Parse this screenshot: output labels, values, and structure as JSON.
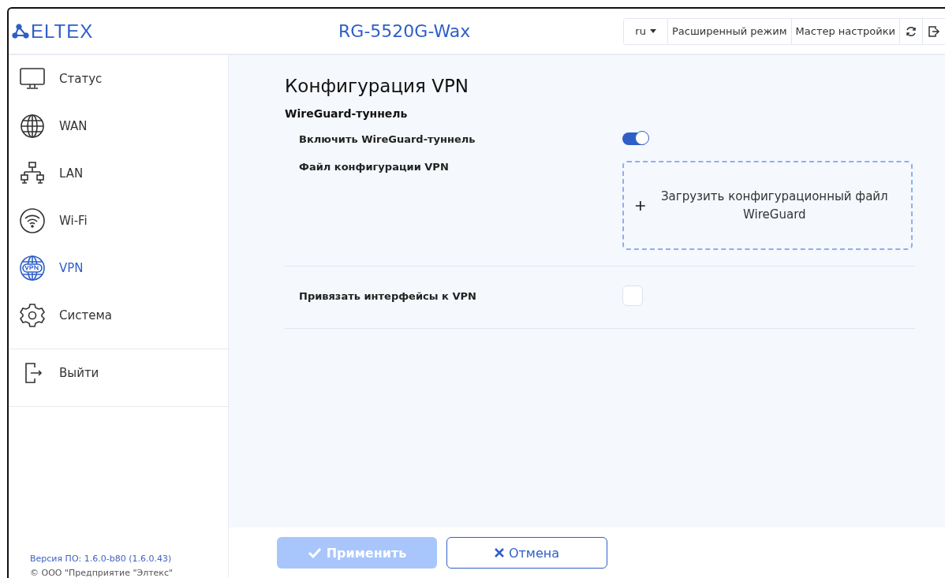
{
  "header": {
    "logo": "ELTEX",
    "title": "RG-5520G-Wax",
    "language": "ru",
    "buttons": [
      {
        "label": "Расширенный режим",
        "kind": "text"
      },
      {
        "label": "Мастер настройки",
        "kind": "text"
      },
      {
        "kind": "refresh"
      },
      {
        "kind": "logout"
      }
    ]
  },
  "sidebar": {
    "items": [
      {
        "label": "Статус",
        "kind": "monitor",
        "selected": false
      },
      {
        "label": "WAN",
        "kind": "globe",
        "selected": false
      },
      {
        "label": "LAN",
        "kind": "network",
        "selected": false
      },
      {
        "label": "Wi-Fi",
        "kind": "wifi",
        "selected": false
      },
      {
        "label": "VPN",
        "kind": "vpn",
        "selected": true
      },
      {
        "label": "Система",
        "kind": "gear",
        "selected": false
      }
    ],
    "exit": "Выйти",
    "version": "Версия ПО: 1.6.0-b80 (1.6.0.43)",
    "copyright": "© ООО \"Предприятие \"Элтекс\""
  },
  "content": {
    "title": "Конфигурация VPN",
    "section": "WireGuard-туннель",
    "rows": [
      {
        "kind": "toggle",
        "label": "Включить WireGuard-туннель",
        "on": true
      },
      {
        "kind": "upload",
        "label": "Файл конфигурации VPN",
        "button": "Загрузить конфигурационный файл WireGuard"
      },
      {
        "kind": "checkbox",
        "label": "Привязать интерфейсы к VPN",
        "checked": false
      }
    ]
  },
  "footer": {
    "apply": {
      "label": "Применить",
      "disabled": true
    },
    "cancel": {
      "label": "Отмена"
    }
  }
}
